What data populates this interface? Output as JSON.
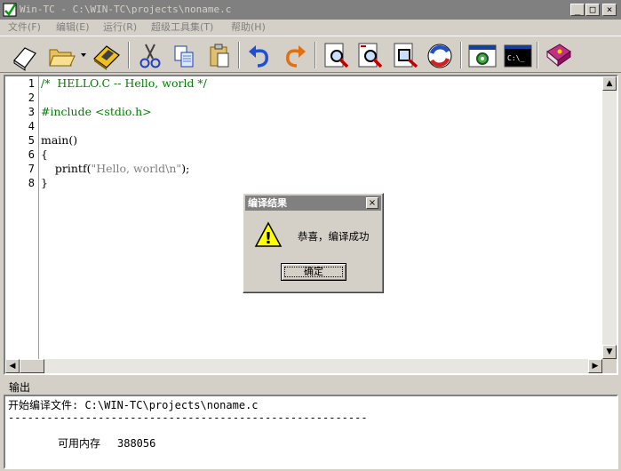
{
  "window": {
    "title": "Win-TC - C:\\WIN-TC\\projects\\noname.c",
    "min_glyph": "_",
    "max_glyph": "□",
    "close_glyph": "×"
  },
  "menu": [
    {
      "label": "文件(F)"
    },
    {
      "label": "编辑(E)"
    },
    {
      "label": "运行(R)"
    },
    {
      "label": "超级工具集(T)"
    },
    {
      "label": "帮助(H)"
    }
  ],
  "toolbar": {
    "icons": [
      "new-file-icon",
      "open-folder-icon",
      "save-disk-icon",
      "cut-icon",
      "copy-icon",
      "paste-icon",
      "undo-icon",
      "redo-icon",
      "find-icon",
      "find-next-icon",
      "replace-icon",
      "refresh-compile-icon",
      "compile-run-icon",
      "dos-console-icon",
      "help-book-icon"
    ]
  },
  "editor": {
    "line_numbers": [
      "1",
      "2",
      "3",
      "4",
      "5",
      "6",
      "7",
      "8"
    ],
    "lines": {
      "l1": "/*  HELLO.C -- Hello, world */",
      "l3": "#include <stdio.h>",
      "l5": "main()",
      "l6": "{",
      "l7_pre": "    printf(",
      "l7_str": "\"Hello, world\\n\"",
      "l7_post": ");",
      "l8": "}"
    }
  },
  "output": {
    "label": "输出",
    "line1": "开始编译文件: C:\\WIN-TC\\projects\\noname.c",
    "divider": "--------------------------------------------------------",
    "mem_label": "可用内存",
    "mem_value": "388056"
  },
  "dialog": {
    "title": "编译结果",
    "message": "恭喜，编译成功",
    "ok_label": "确定",
    "close_glyph": "×",
    "warning_glyph": "!"
  },
  "colors": {
    "comment": "#008000",
    "string": "#808080",
    "titlebar_inactive": "#808080",
    "face": "#d4d0c8"
  }
}
